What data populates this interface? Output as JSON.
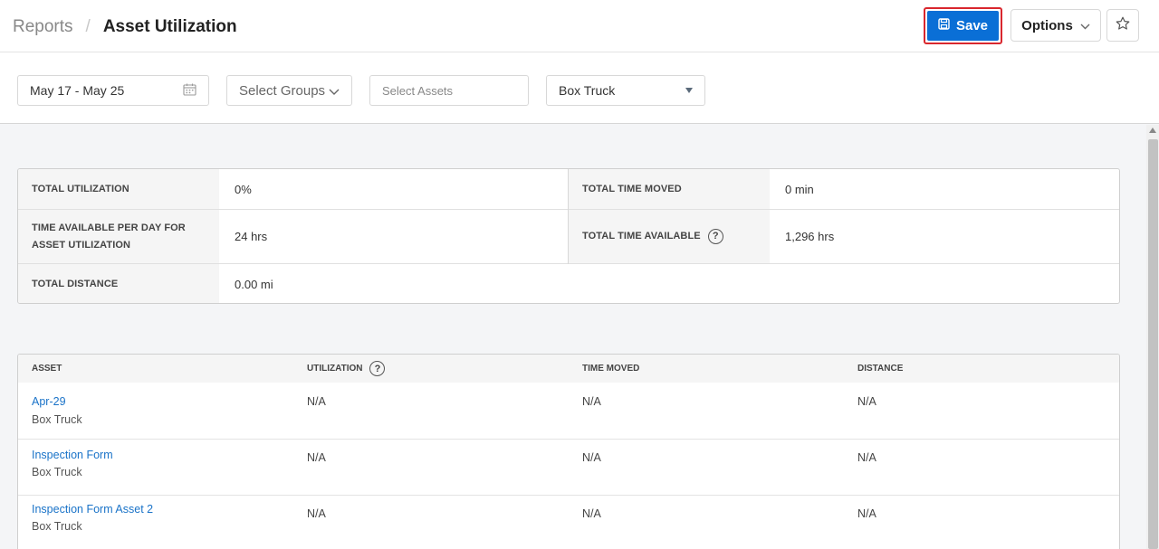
{
  "breadcrumb": {
    "root": "Reports",
    "separator": "/",
    "current": "Asset Utilization"
  },
  "header": {
    "save_label": "Save",
    "options_label": "Options"
  },
  "filters": {
    "date_range": "May 17 - May 25",
    "groups_placeholder": "Select Groups",
    "assets_placeholder": "Select Assets",
    "asset_type": "Box Truck"
  },
  "summary": {
    "total_utilization_label": "TOTAL UTILIZATION",
    "total_utilization_value": "0%",
    "total_time_moved_label": "TOTAL TIME MOVED",
    "total_time_moved_value": "0 min",
    "time_available_label_line1": "TIME AVAILABLE PER DAY FOR",
    "time_available_label_line2": "ASSET UTILIZATION",
    "time_available_value": "24 hrs",
    "total_time_available_label": "TOTAL TIME AVAILABLE",
    "total_time_available_value": "1,296 hrs",
    "total_distance_label": "TOTAL DISTANCE",
    "total_distance_value": "0.00 mi"
  },
  "table": {
    "columns": [
      "ASSET",
      "UTILIZATION",
      "TIME MOVED",
      "DISTANCE"
    ],
    "rows": [
      {
        "name": "Apr-29",
        "type": "Box Truck",
        "utilization": "N/A",
        "time_moved": "N/A",
        "distance": "N/A"
      },
      {
        "name": "Inspection Form",
        "type": "Box Truck",
        "utilization": "N/A",
        "time_moved": "N/A",
        "distance": "N/A"
      },
      {
        "name": "Inspection Form Asset 2",
        "type": "Box Truck",
        "utilization": "N/A",
        "time_moved": "N/A",
        "distance": "N/A"
      }
    ]
  },
  "icons": {
    "save": "save-icon",
    "options_chevron": "chevron-down-icon",
    "favorite": "star-icon",
    "calendar": "calendar-icon",
    "dropdown": "chevron-down-icon",
    "help": "help-circle-icon"
  },
  "colors": {
    "primary": "#0a6fd6",
    "highlight_border": "#d9272e",
    "link": "#1a73c8"
  }
}
